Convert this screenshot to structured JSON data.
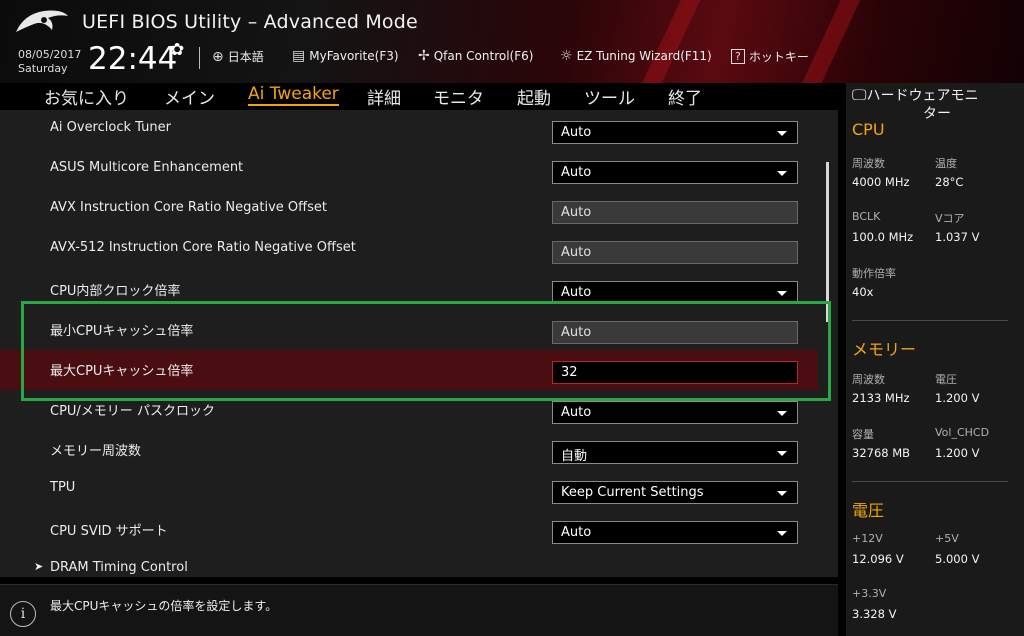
{
  "header": {
    "title": "UEFI BIOS Utility – Advanced Mode",
    "date": "08/05/2017",
    "day": "Saturday",
    "time": "22:44",
    "items": [
      {
        "icon": "globe-icon",
        "label": "日本語"
      },
      {
        "icon": "favorite-icon",
        "label": "MyFavorite(F3)"
      },
      {
        "icon": "fan-icon",
        "label": "Qfan Control(F6)"
      },
      {
        "icon": "bulb-icon",
        "label": "EZ Tuning Wizard(F11)"
      },
      {
        "icon": "help-icon",
        "label": "ホットキー"
      }
    ]
  },
  "tabs": [
    "お気に入り",
    "メイン",
    "Ai Tweaker",
    "詳細",
    "モニタ",
    "起動",
    "ツール",
    "終了"
  ],
  "active_tab": "Ai Tweaker",
  "settings": [
    {
      "label": "Ai Overclock Tuner",
      "value": "Auto",
      "type": "select"
    },
    {
      "label": "ASUS Multicore Enhancement",
      "value": "Auto",
      "type": "select"
    },
    {
      "label": "AVX Instruction Core Ratio Negative Offset",
      "value": "Auto",
      "type": "disabled"
    },
    {
      "label": "AVX-512 Instruction Core Ratio Negative Offset",
      "value": "Auto",
      "type": "disabled"
    },
    {
      "label": "CPU内部クロック倍率",
      "value": "Auto",
      "type": "select"
    },
    {
      "label": "最小CPUキャッシュ倍率",
      "value": "Auto",
      "type": "disabled"
    },
    {
      "label": "最大CPUキャッシュ倍率",
      "value": "32",
      "type": "input"
    },
    {
      "label": "CPU/メモリー パスクロック",
      "value": "Auto",
      "type": "select"
    },
    {
      "label": "メモリー周波数",
      "value": "自動",
      "type": "select"
    },
    {
      "label": "TPU",
      "value": "Keep Current Settings",
      "type": "select"
    },
    {
      "label": "CPU SVID サポート",
      "value": "Auto",
      "type": "select"
    }
  ],
  "submenu": {
    "label": "DRAM Timing Control"
  },
  "help_text": "最大CPUキャッシュの倍率を設定します。",
  "monitor": {
    "title": "ハードウェアモニター",
    "title_line1": "ハードウェアモニ",
    "title_line2": "ター",
    "cpu": {
      "title": "CPU",
      "freq_label": "周波数",
      "freq": "4000 MHz",
      "temp_label": "温度",
      "temp": "28°C",
      "bclk_label": "BCLK",
      "bclk": "100.0 MHz",
      "vcore_label": "Vコア",
      "vcore": "1.037 V",
      "ratio_label": "動作倍率",
      "ratio": "40x"
    },
    "memory": {
      "title": "メモリー",
      "freq_label": "周波数",
      "freq": "2133 MHz",
      "volt_label": "電圧",
      "volt": "1.200 V",
      "cap_label": "容量",
      "cap": "32768 MB",
      "vol_chcd_label": "Vol_CHCD",
      "vol_chcd": "1.200 V"
    },
    "voltage": {
      "title": "電圧",
      "v12_label": "+12V",
      "v12": "12.096 V",
      "v5_label": "+5V",
      "v5": "5.000 V",
      "v33_label": "+3.3V",
      "v33": "3.328 V"
    }
  },
  "colors": {
    "accent": "#f3a40c",
    "highlight_row": "#4a0e12",
    "annotation_box": "#28a745"
  }
}
